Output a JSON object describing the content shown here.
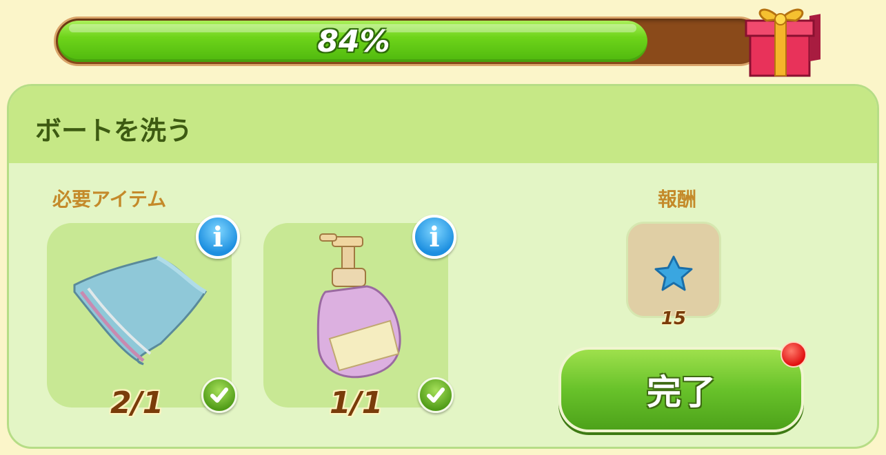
{
  "progress": {
    "value": 0.84,
    "label": "84%"
  },
  "task": {
    "title": "ボートを洗う"
  },
  "required": {
    "label": "必要アイテム",
    "items": [
      {
        "name": "towel",
        "count": "2/1",
        "done": true
      },
      {
        "name": "soap",
        "count": "1/1",
        "done": true
      }
    ]
  },
  "reward": {
    "label": "報酬",
    "amount": "15"
  },
  "complete_button": {
    "label": "完了"
  },
  "colors": {
    "progress_fill": "#6ed41a",
    "progress_track": "#8a4a1a",
    "panel": "#e3f5c5",
    "header": "#c6e886"
  }
}
